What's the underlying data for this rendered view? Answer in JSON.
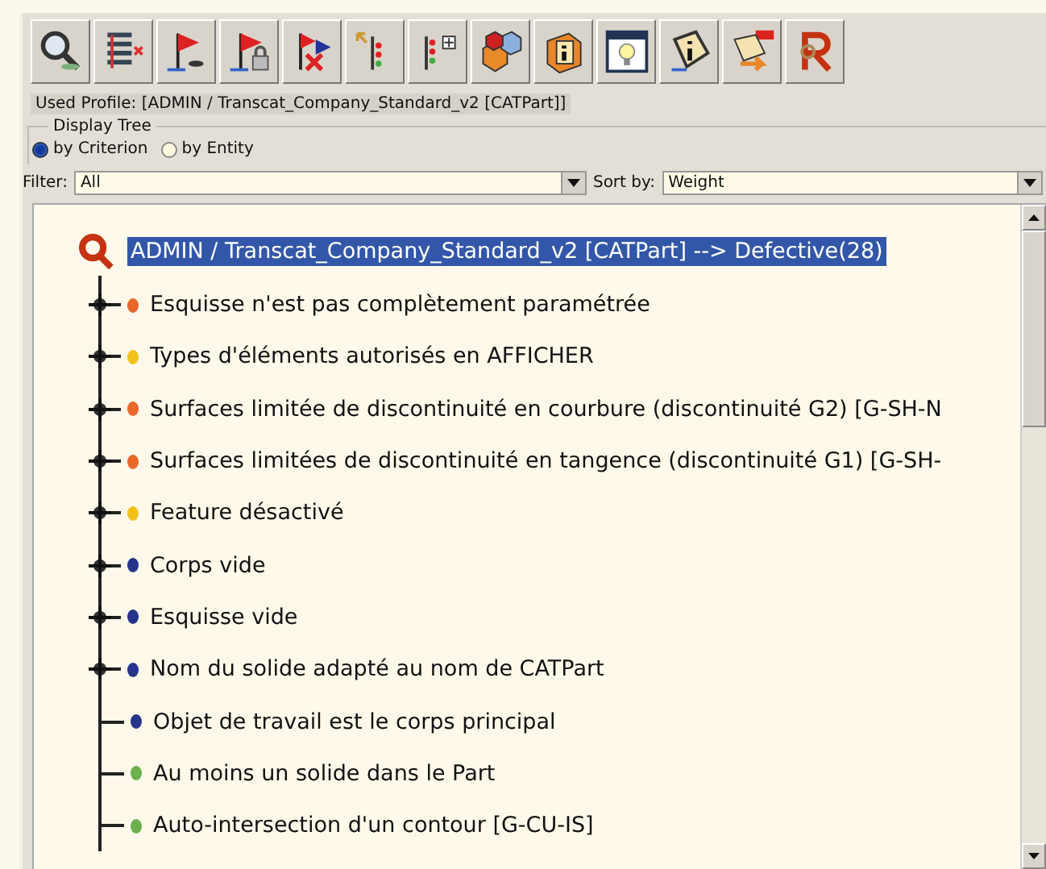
{
  "toolbar": [
    {
      "kind": "search"
    },
    {
      "kind": "list"
    },
    {
      "kind": "flag"
    },
    {
      "kind": "flag_lock"
    },
    {
      "kind": "flag_cross"
    },
    {
      "kind": "tree_arrow"
    },
    {
      "kind": "tree_plus"
    },
    {
      "kind": "cubes"
    },
    {
      "kind": "info_box"
    },
    {
      "kind": "bulb"
    },
    {
      "kind": "info_sign"
    },
    {
      "kind": "report"
    },
    {
      "kind": "logo"
    }
  ],
  "profile": "Used Profile:  [ADMIN / Transcat_Company_Standard_v2 [CATPart]]",
  "display_tree": {
    "title": "Display Tree",
    "options": [
      {
        "label": "by Criterion",
        "selected": true
      },
      {
        "label": "by Entity",
        "selected": false
      }
    ]
  },
  "filter": {
    "label": "Filter:",
    "value": "All"
  },
  "sort": {
    "label": "Sort by:",
    "value": "Weight"
  },
  "tree": {
    "label": "ADMIN / Transcat_Company_Standard_v2 [CATPart] --> Defective(28)",
    "selected": true,
    "children": [
      {
        "label": "Esquisse n'est pas complètement paramétrée",
        "color": "#e8682a",
        "expandable": true
      },
      {
        "label": "Types d'éléments autorisés en AFFICHER",
        "color": "#f2c21c",
        "expandable": true
      },
      {
        "label": "Surfaces limitée de discontinuité en courbure (discontinuité G2) [G-SH-N",
        "color": "#e8682a",
        "expandable": true
      },
      {
        "label": "Surfaces limitées de discontinuité en tangence (discontinuité G1) [G-SH-",
        "color": "#e8682a",
        "expandable": true
      },
      {
        "label": "Feature désactivé",
        "color": "#f2c21c",
        "expandable": true
      },
      {
        "label": "Corps vide",
        "color": "#26348c",
        "expandable": true
      },
      {
        "label": "Esquisse vide",
        "color": "#26348c",
        "expandable": true
      },
      {
        "label": "Nom du solide adapté au nom de CATPart",
        "color": "#26348c",
        "expandable": true
      },
      {
        "label": "Objet de travail est le corps principal",
        "color": "#26348c",
        "expandable": false
      },
      {
        "label": "Au moins un solide dans le Part",
        "color": "#6ab04c",
        "expandable": false
      },
      {
        "label": "Auto-intersection d'un contour [G-CU-IS]",
        "color": "#6ab04c",
        "expandable": false
      }
    ]
  }
}
